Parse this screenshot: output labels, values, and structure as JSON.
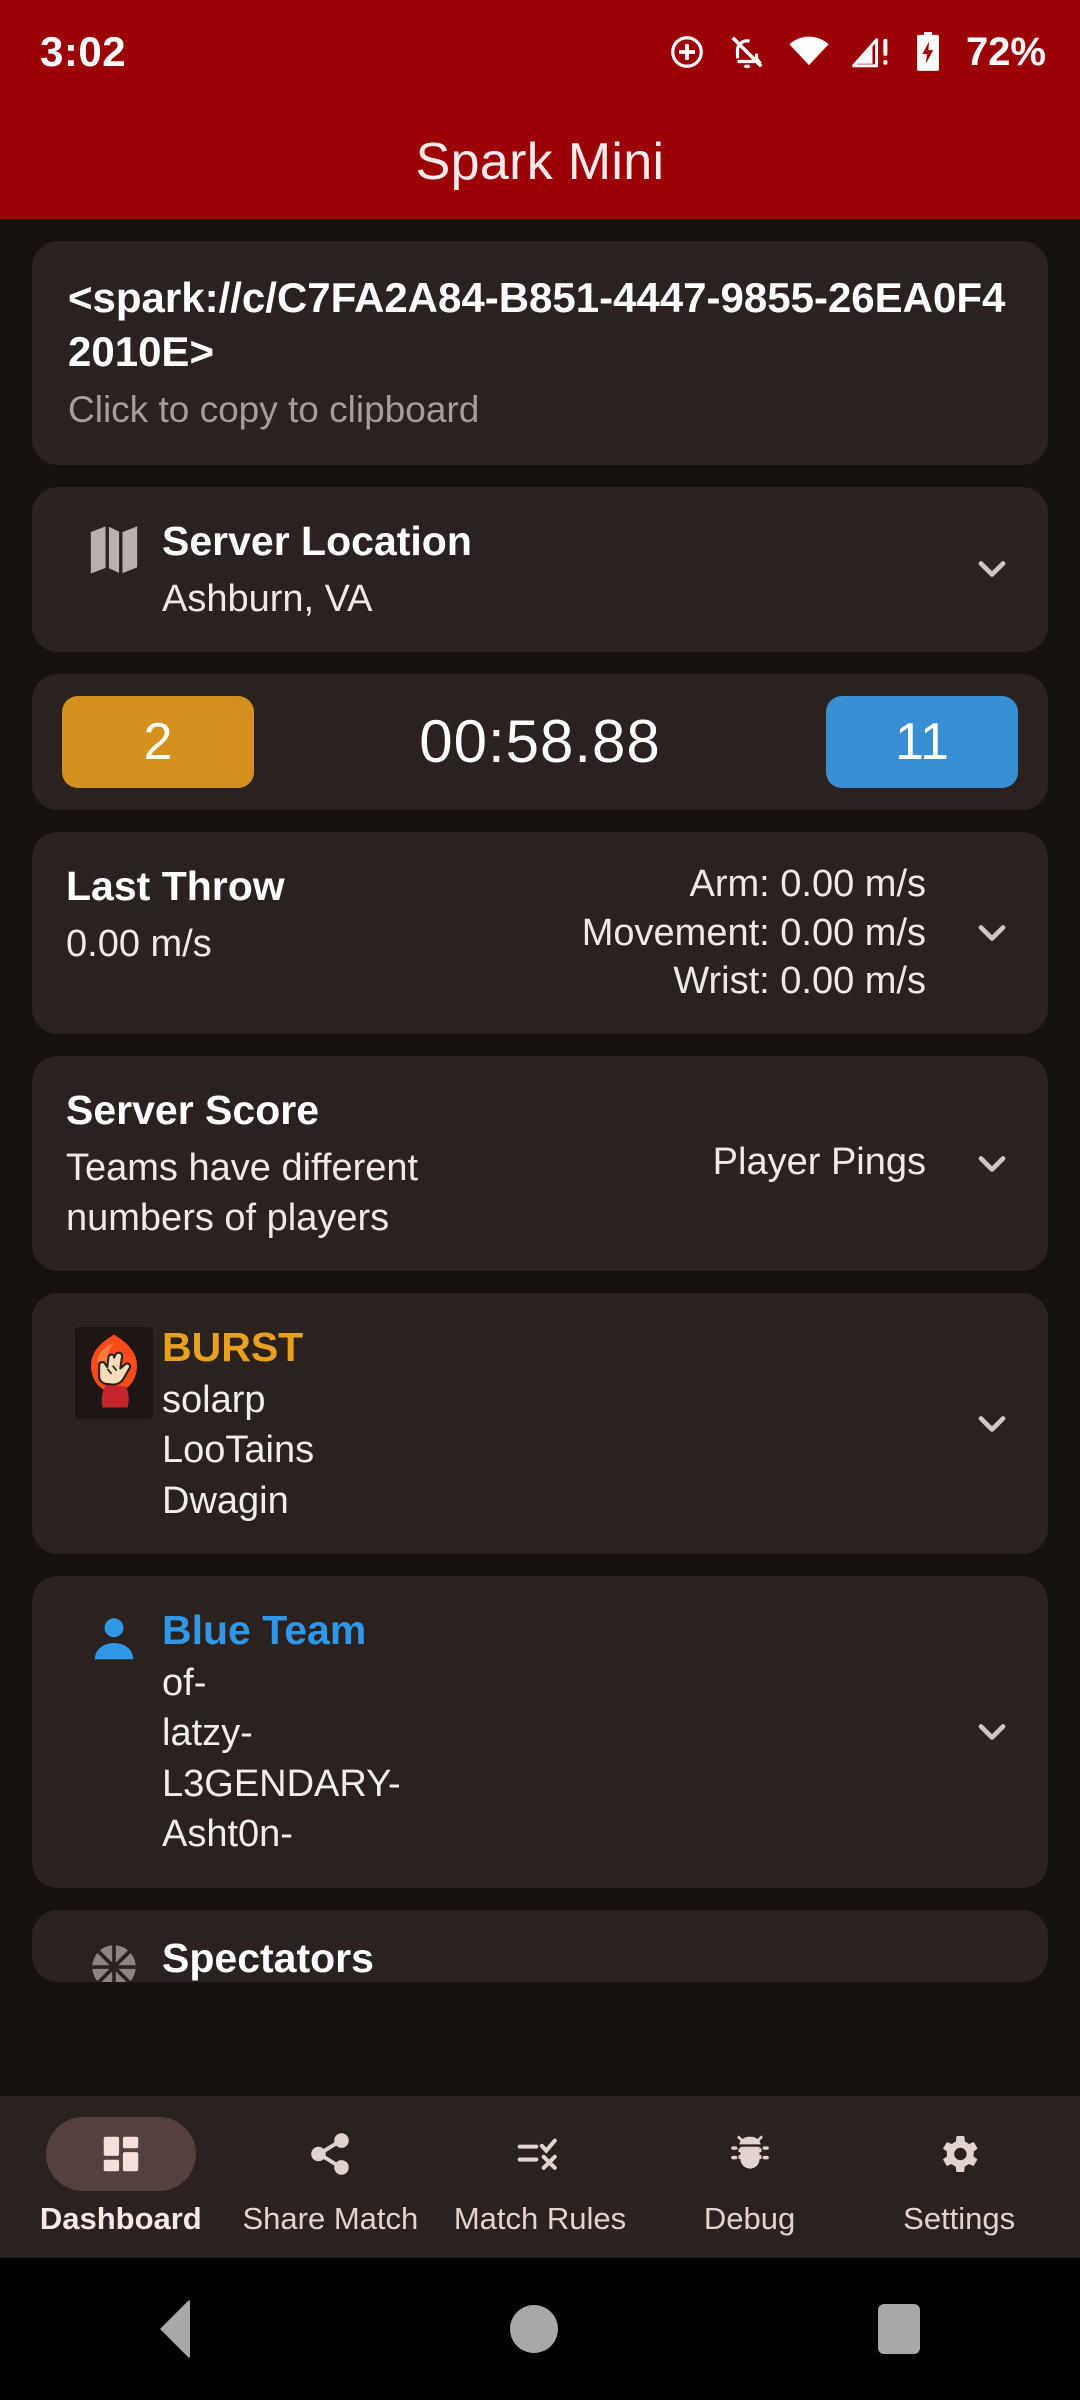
{
  "status_bar": {
    "time": "3:02",
    "battery_percent": "72%",
    "icons": [
      "location-target-icon",
      "notifications-off-icon",
      "wifi-icon",
      "cellular-signal-warning-icon",
      "battery-charging-icon"
    ]
  },
  "app_bar": {
    "title": "Spark Mini"
  },
  "url_card": {
    "url": "<spark://c/C7FA2A84-B851-4447-9855-26EA0F42010E>",
    "hint": "Click to copy to clipboard"
  },
  "server_location": {
    "icon": "map-icon",
    "title": "Server Location",
    "value": "Ashburn, VA",
    "chevron": "chevron-down-icon"
  },
  "score": {
    "orange_score": "2",
    "clock": "00:58.88",
    "blue_score": "11",
    "orange_color": "#d4901f",
    "blue_color": "#3a8fd4"
  },
  "last_throw": {
    "title": "Last Throw",
    "speed": "0.00 m/s",
    "metrics": [
      "Arm: 0.00 m/s",
      "Movement: 0.00 m/s",
      "Wrist: 0.00 m/s"
    ],
    "chevron": "chevron-down-icon"
  },
  "server_score": {
    "title": "Server Score",
    "message": "Teams have different numbers of players",
    "right_label": "Player Pings",
    "chevron": "chevron-down-icon"
  },
  "orange_team": {
    "icon": "burst-hand-logo-icon",
    "name": "BURST",
    "name_color": "#e8a020",
    "players": [
      "solarp",
      "LooTains",
      "Dwagin"
    ],
    "chevron": "chevron-down-icon"
  },
  "blue_team": {
    "icon": "person-icon",
    "name": "Blue Team",
    "name_color": "#2f97e8",
    "players": [
      "of-",
      "latzy-",
      "L3GENDARY-",
      "Asht0n-"
    ],
    "chevron": "chevron-down-icon"
  },
  "spectators": {
    "icon": "spectator-icon",
    "title": "Spectators"
  },
  "bottom_nav": {
    "items": [
      {
        "label": "Dashboard",
        "icon": "dashboard-grid-icon",
        "active": true
      },
      {
        "label": "Share Match",
        "icon": "share-icon",
        "active": false
      },
      {
        "label": "Match Rules",
        "icon": "rules-checklist-icon",
        "active": false
      },
      {
        "label": "Debug",
        "icon": "bug-icon",
        "active": false
      },
      {
        "label": "Settings",
        "icon": "gear-icon",
        "active": false
      }
    ]
  },
  "android_nav": {
    "back": "back-triangle-icon",
    "home": "home-circle-icon",
    "recents": "recents-square-icon"
  }
}
